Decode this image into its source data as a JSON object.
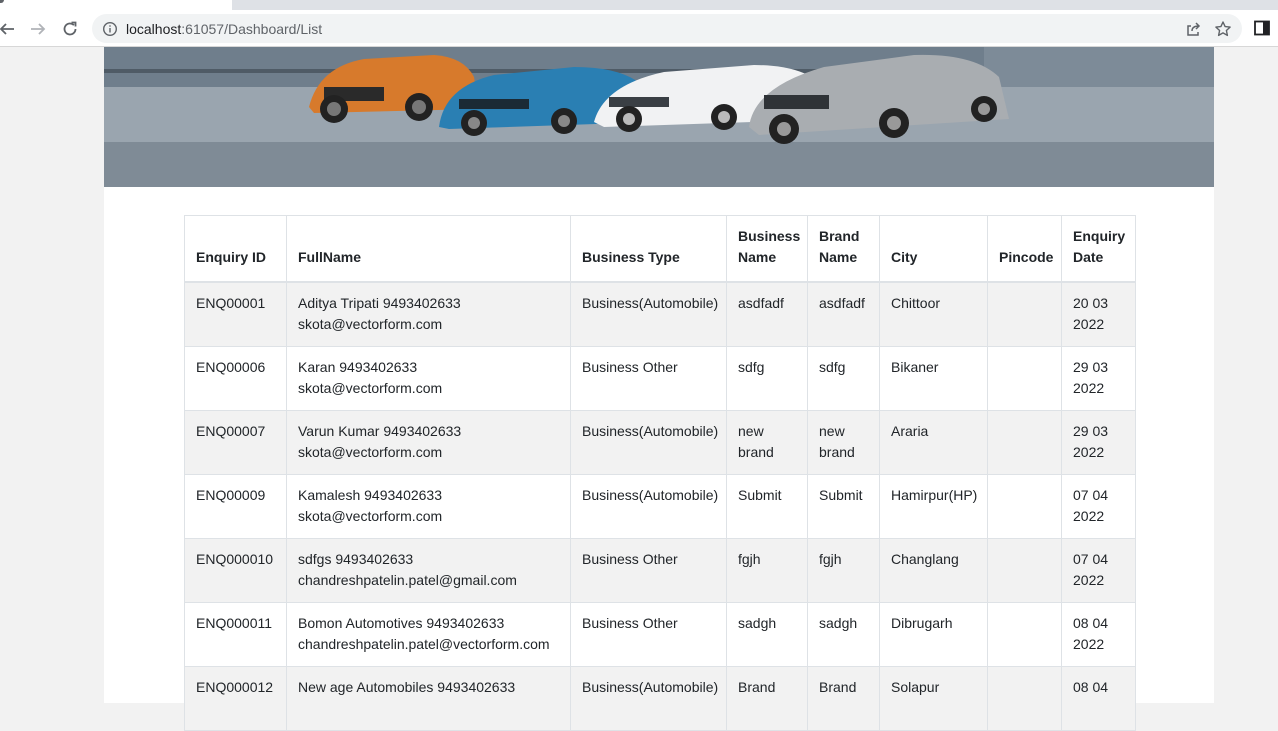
{
  "browser": {
    "url_host": "localhost",
    "url_rest": ":61057/Dashboard/List"
  },
  "icons": {
    "back": "back-arrow-icon",
    "forward": "forward-arrow-icon",
    "reload": "reload-icon",
    "info": "info-icon",
    "share": "share-icon",
    "bookmark": "star-icon",
    "sidepanel": "side-panel-icon"
  },
  "colors": {
    "row_stripe": "#f2f2f2",
    "border": "#dee2e6",
    "page_bg": "#f2f2f2"
  },
  "table": {
    "headers": [
      "Enquiry ID",
      "FullName",
      "Business Type",
      "Business Name",
      "Brand Name",
      "City",
      "Pincode",
      "Enquiry Date"
    ],
    "rows": [
      {
        "id": "ENQ00001",
        "name": "Aditya Tripati 9493402633",
        "email": "skota@vectorform.com",
        "type": "Business(Automobile)",
        "business": "asdfadf",
        "brand": "asdfadf",
        "city": "Chittoor",
        "pincode": "",
        "date": "20 03 2022"
      },
      {
        "id": "ENQ00006",
        "name": "Karan 9493402633",
        "email": "skota@vectorform.com",
        "type": "Business Other",
        "business": "sdfg",
        "brand": "sdfg",
        "city": "Bikaner",
        "pincode": "",
        "date": "29 03 2022"
      },
      {
        "id": "ENQ00007",
        "name": "Varun Kumar 9493402633",
        "email": "skota@vectorform.com",
        "type": "Business(Automobile)",
        "business": "new brand",
        "brand": "new brand",
        "city": "Araria",
        "pincode": "",
        "date": "29 03 2022"
      },
      {
        "id": "ENQ00009",
        "name": "Kamalesh 9493402633",
        "email": "skota@vectorform.com",
        "type": "Business(Automobile)",
        "business": "Submit",
        "brand": "Submit",
        "city": "Hamirpur(HP)",
        "pincode": "",
        "date": "07 04 2022"
      },
      {
        "id": "ENQ000010",
        "name": "sdfgs 9493402633",
        "email": "chandreshpatelin.patel@gmail.com",
        "type": "Business Other",
        "business": "fgjh",
        "brand": "fgjh",
        "city": "Changlang",
        "pincode": "",
        "date": "07 04 2022"
      },
      {
        "id": "ENQ000011",
        "name": "Bomon Automotives 9493402633",
        "email": "chandreshpatelin.patel@vectorform.com",
        "type": "Business Other",
        "business": "sadgh",
        "brand": "sadgh",
        "city": "Dibrugarh",
        "pincode": "",
        "date": "08 04 2022"
      },
      {
        "id": "ENQ000012",
        "name": "New age Automobiles 9493402633",
        "email": "",
        "type": "Business(Automobile)",
        "business": "Brand",
        "brand": "Brand",
        "city": "Solapur",
        "pincode": "",
        "date": "08 04"
      }
    ]
  }
}
